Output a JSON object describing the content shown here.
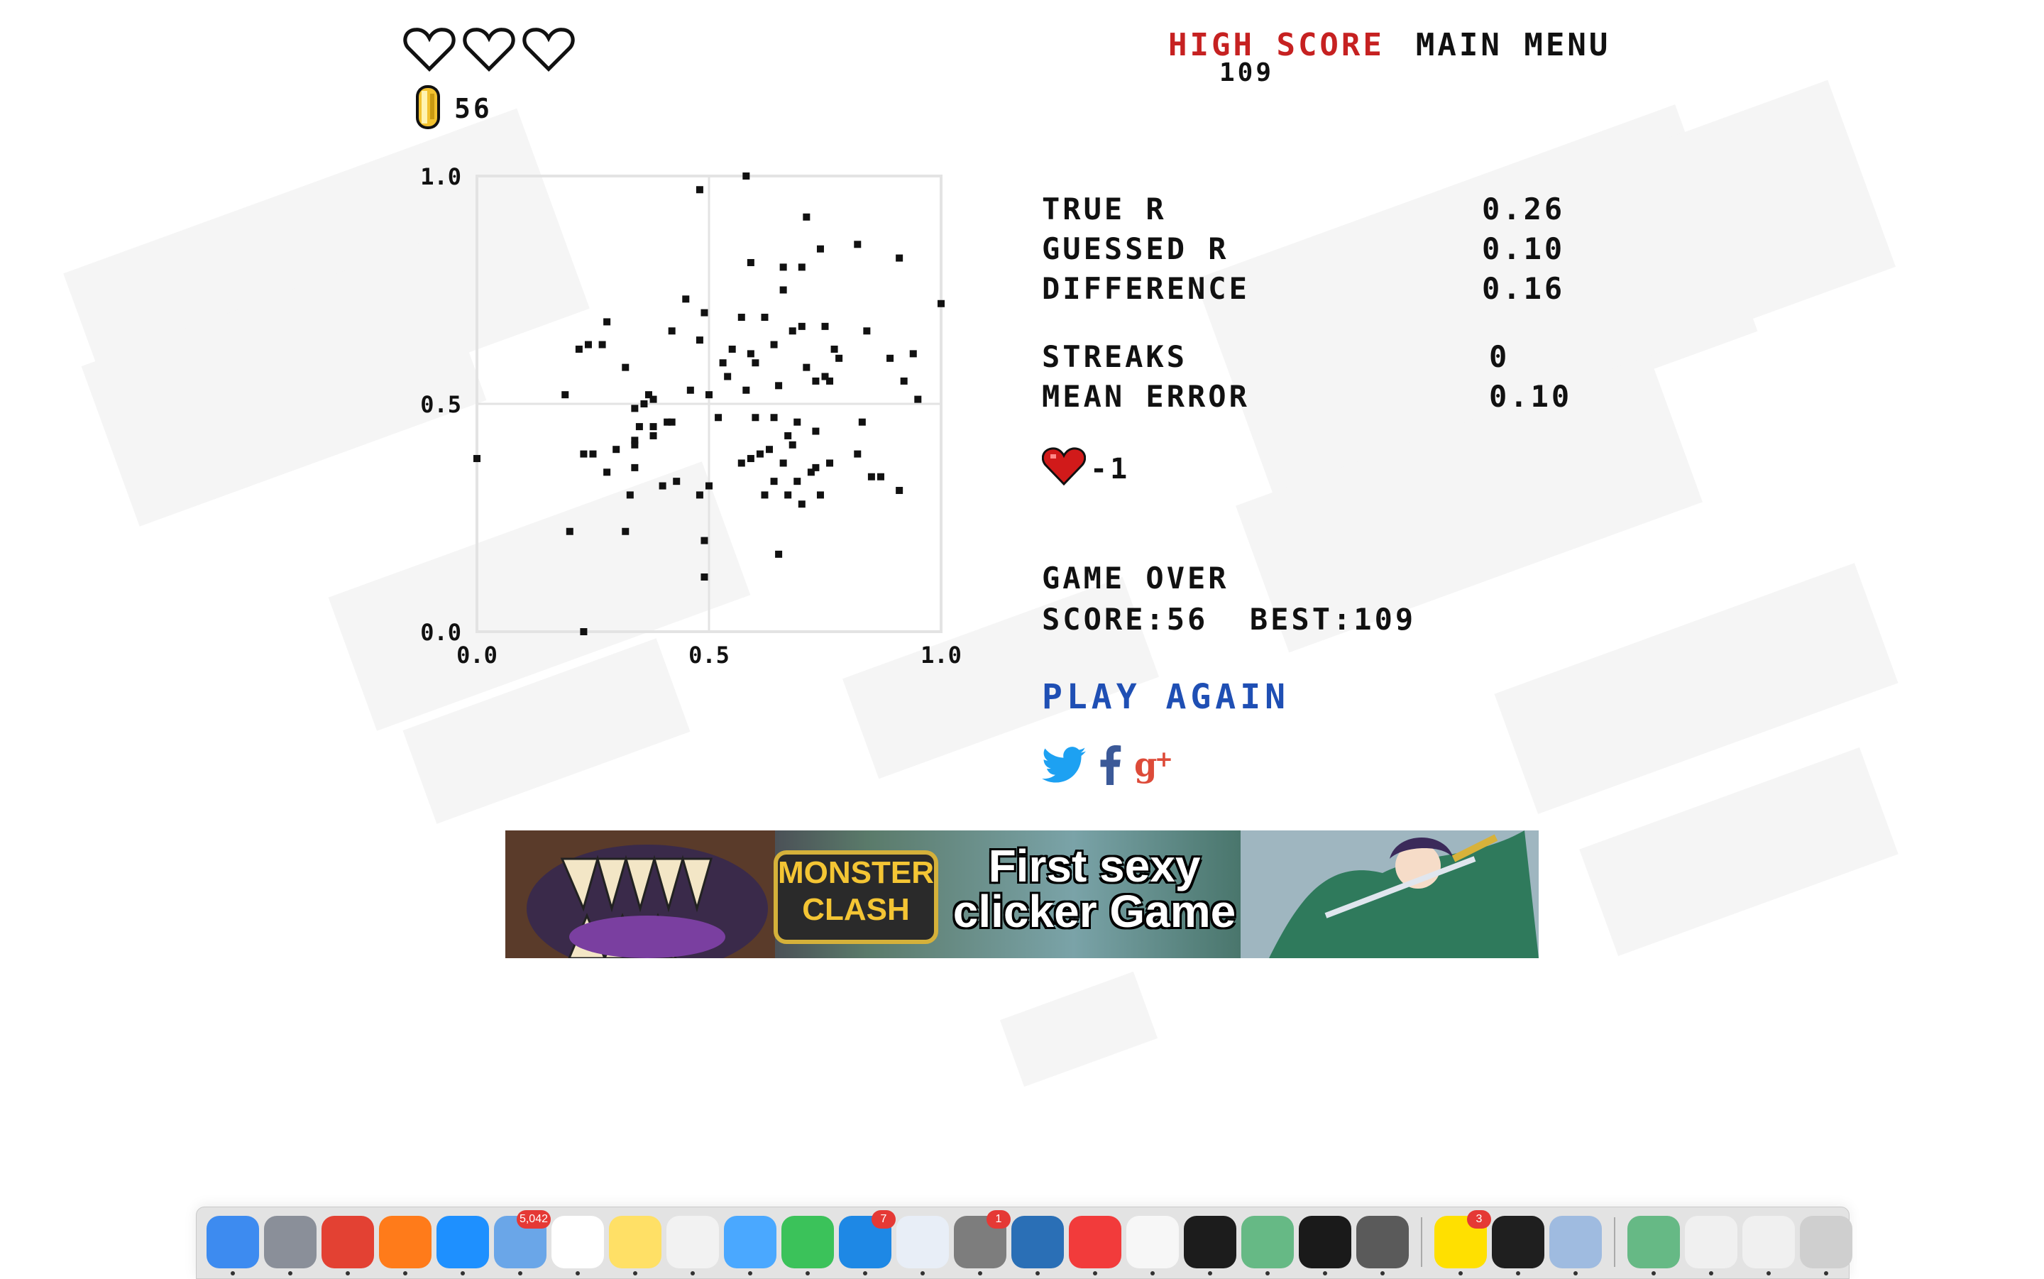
{
  "hud": {
    "lives": [
      {
        "state": "empty"
      },
      {
        "state": "empty"
      },
      {
        "state": "empty"
      }
    ],
    "coin_count": "56",
    "high_score_label": "HIGH SCORE",
    "high_score_value": "109",
    "main_menu_label": "MAIN MENU"
  },
  "stats": {
    "true_r_label": "TRUE R",
    "true_r_value": "0.26",
    "guessed_r_label": "GUESSED R",
    "guessed_r_value": "0.10",
    "difference_label": "DIFFERENCE",
    "difference_value": "0.16",
    "streaks_label": "STREAKS",
    "streaks_value": "0",
    "mean_error_label": "MEAN ERROR",
    "mean_error_value": "0.10",
    "life_change": "-1"
  },
  "result": {
    "game_over": "GAME OVER",
    "score_line": "SCORE:56  BEST:109",
    "play_again": "PLAY AGAIN"
  },
  "social": {
    "icons": [
      "twitter-icon",
      "facebook-icon",
      "google-plus-icon"
    ],
    "colors": {
      "twitter": "#1da1f2",
      "facebook": "#3b5998",
      "google_plus": "#dd4b39"
    }
  },
  "ad": {
    "logo_text": "MONSTER CLASH",
    "headline": "First sexy clicker Game"
  },
  "colors": {
    "accent_red": "#c62121",
    "link_blue": "#1f4fb4"
  },
  "chart_data": {
    "type": "scatter",
    "xlim": [
      0,
      1
    ],
    "ylim": [
      0,
      1
    ],
    "grid": true,
    "x_ticks": [
      "0.0",
      "0.5",
      "1.0"
    ],
    "y_ticks": [
      "0.0",
      "0.5",
      "1.0"
    ],
    "points": [
      [
        0.58,
        1.0
      ],
      [
        0.48,
        0.97
      ],
      [
        0.71,
        0.91
      ],
      [
        0.91,
        0.82
      ],
      [
        0.82,
        0.85
      ],
      [
        0.74,
        0.84
      ],
      [
        0.7,
        0.8
      ],
      [
        0.66,
        0.8
      ],
      [
        0.59,
        0.81
      ],
      [
        0.66,
        0.75
      ],
      [
        1.0,
        0.72
      ],
      [
        0.45,
        0.73
      ],
      [
        0.49,
        0.7
      ],
      [
        0.28,
        0.68
      ],
      [
        0.62,
        0.69
      ],
      [
        0.57,
        0.69
      ],
      [
        0.75,
        0.67
      ],
      [
        0.84,
        0.66
      ],
      [
        0.7,
        0.67
      ],
      [
        0.68,
        0.66
      ],
      [
        0.42,
        0.66
      ],
      [
        0.48,
        0.64
      ],
      [
        0.27,
        0.63
      ],
      [
        0.22,
        0.62
      ],
      [
        0.24,
        0.63
      ],
      [
        0.55,
        0.62
      ],
      [
        0.64,
        0.63
      ],
      [
        0.77,
        0.62
      ],
      [
        0.59,
        0.61
      ],
      [
        0.6,
        0.59
      ],
      [
        0.78,
        0.6
      ],
      [
        0.94,
        0.61
      ],
      [
        0.89,
        0.6
      ],
      [
        0.32,
        0.58
      ],
      [
        0.53,
        0.59
      ],
      [
        0.71,
        0.58
      ],
      [
        0.75,
        0.56
      ],
      [
        0.54,
        0.56
      ],
      [
        0.73,
        0.55
      ],
      [
        0.76,
        0.55
      ],
      [
        0.92,
        0.55
      ],
      [
        0.58,
        0.53
      ],
      [
        0.65,
        0.54
      ],
      [
        0.46,
        0.53
      ],
      [
        0.5,
        0.52
      ],
      [
        0.19,
        0.52
      ],
      [
        0.37,
        0.52
      ],
      [
        0.38,
        0.51
      ],
      [
        0.95,
        0.51
      ],
      [
        0.36,
        0.5
      ],
      [
        0.34,
        0.49
      ],
      [
        0.6,
        0.47
      ],
      [
        0.64,
        0.47
      ],
      [
        0.52,
        0.47
      ],
      [
        0.41,
        0.46
      ],
      [
        0.42,
        0.46
      ],
      [
        0.69,
        0.46
      ],
      [
        0.83,
        0.46
      ],
      [
        0.38,
        0.45
      ],
      [
        0.35,
        0.45
      ],
      [
        0.73,
        0.44
      ],
      [
        0.38,
        0.43
      ],
      [
        0.67,
        0.43
      ],
      [
        0.34,
        0.42
      ],
      [
        0.3,
        0.4
      ],
      [
        0.34,
        0.41
      ],
      [
        0.68,
        0.41
      ],
      [
        0.63,
        0.4
      ],
      [
        0.23,
        0.39
      ],
      [
        0.25,
        0.39
      ],
      [
        0.82,
        0.39
      ],
      [
        0.61,
        0.39
      ],
      [
        0.0,
        0.38
      ],
      [
        0.59,
        0.38
      ],
      [
        0.76,
        0.37
      ],
      [
        0.66,
        0.37
      ],
      [
        0.57,
        0.37
      ],
      [
        0.73,
        0.36
      ],
      [
        0.34,
        0.36
      ],
      [
        0.28,
        0.35
      ],
      [
        0.72,
        0.35
      ],
      [
        0.64,
        0.33
      ],
      [
        0.87,
        0.34
      ],
      [
        0.85,
        0.34
      ],
      [
        0.43,
        0.33
      ],
      [
        0.69,
        0.33
      ],
      [
        0.4,
        0.32
      ],
      [
        0.5,
        0.32
      ],
      [
        0.48,
        0.3
      ],
      [
        0.91,
        0.31
      ],
      [
        0.33,
        0.3
      ],
      [
        0.62,
        0.3
      ],
      [
        0.67,
        0.3
      ],
      [
        0.74,
        0.3
      ],
      [
        0.7,
        0.28
      ],
      [
        0.2,
        0.22
      ],
      [
        0.32,
        0.22
      ],
      [
        0.49,
        0.2
      ],
      [
        0.65,
        0.17
      ],
      [
        0.49,
        0.12
      ],
      [
        0.23,
        0.0
      ]
    ]
  }
}
